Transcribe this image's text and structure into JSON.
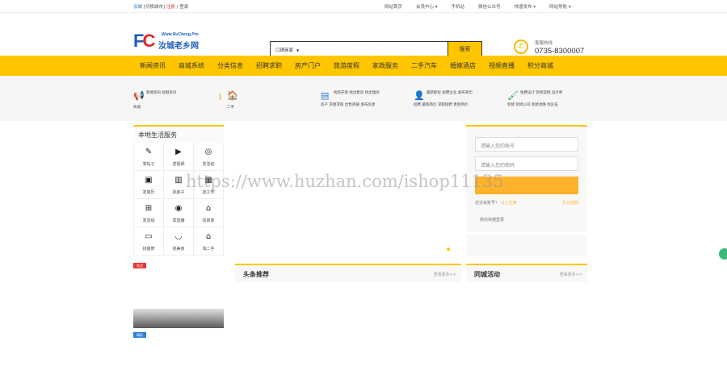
{
  "topbar": {
    "city": "汝城",
    "switch_city": "[切换城市]",
    "register": "注册",
    "slash": "/",
    "login": "登录",
    "links": [
      "网站首页",
      "会员中心 ▾",
      "手机站",
      "微信公众号",
      "快速发布 ▾",
      "网站导航 ▾"
    ]
  },
  "logo": {
    "fc": "FC",
    "cn": "汝城老乡网",
    "www": "Www.RuCheng.Pro"
  },
  "search": {
    "scope": "口碑商家",
    "placeholder": "",
    "button": "搜索"
  },
  "hotline": {
    "label": "客服热线",
    "number": "0735-8300007"
  },
  "nav": [
    "新闻资讯",
    "商城系统",
    "分类信息",
    "招聘求职",
    "房产门户",
    "旅游度假",
    "家政服务",
    "二手汽车",
    "婚嫁酒店",
    "视频直播",
    "积分商城"
  ],
  "strip": {
    "g1": {
      "l1": "新闻资讯  视频资讯",
      "l2": "商城"
    },
    "g2": {
      "l2": "二手"
    },
    "g3": {
      "l1": "找新开盘  找出售房  找出租房",
      "l2": "房产  求租求购  出售商铺  发布房源"
    },
    "g4": {
      "l1": "最新职位  招聘企业  发布简历",
      "l2": "招聘  最新简历  求职招聘  更新简历"
    },
    "g5": {
      "l1": "免费设计  装修案例  设计师",
      "l2": "装修  装修公司  装修攻略  找队伍"
    }
  },
  "side": {
    "title": "本地生活服务",
    "items": [
      {
        "icon": "edit-icon",
        "label": "发帖子"
      },
      {
        "icon": "video-icon",
        "label": "发视频"
      },
      {
        "icon": "location-icon",
        "label": "发活动"
      },
      {
        "icon": "person-card-icon",
        "label": "发简历"
      },
      {
        "icon": "clipboard-icon",
        "label": "找房子"
      },
      {
        "icon": "building-icon",
        "label": "找工作"
      },
      {
        "icon": "gift-icon",
        "label": "发活动"
      },
      {
        "icon": "camera-icon",
        "label": "发直播"
      },
      {
        "icon": "shop-icon",
        "label": "找商家"
      },
      {
        "icon": "paint-roller-icon",
        "label": "找装修"
      },
      {
        "icon": "bowl-icon",
        "label": "找美食"
      },
      {
        "icon": "house-icon",
        "label": "淘二手"
      }
    ]
  },
  "tags": {
    "red": "热点",
    "blue": "精彩"
  },
  "login": {
    "user_placeholder": "请输入您的账号",
    "pass_placeholder": "请输入您的密码",
    "no_account": "还没有账号？",
    "register_now": "马上注册",
    "forgot": "忘记密码",
    "wechat": "微信快捷登录"
  },
  "sections": {
    "headline": {
      "title": "头条推荐",
      "more": "查看更多>>"
    },
    "activity": {
      "title": "同城活动",
      "more": "查看更多>>"
    }
  },
  "watermark": "https://www.huzhan.com/ishop11135",
  "colors": {
    "accent": "#ffc600",
    "brand_blue": "#1b5ebd",
    "login_button": "#ffb22c"
  }
}
